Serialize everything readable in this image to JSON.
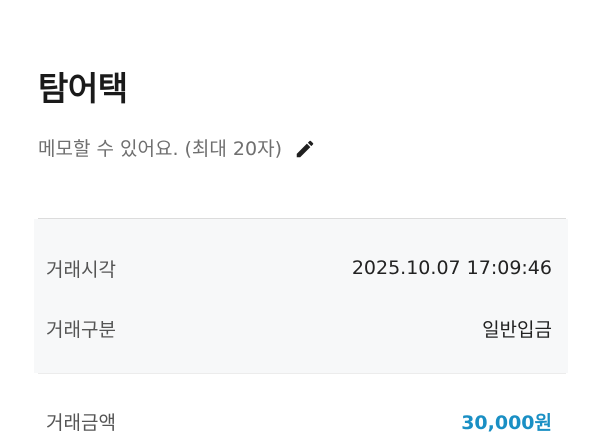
{
  "header": {
    "title": "탐어택"
  },
  "memo": {
    "placeholder": "메모할 수 있어요. (최대 20자)",
    "edit_icon": "pencil-icon"
  },
  "details": {
    "time_label": "거래시각",
    "time_value": "2025.10.07 17:09:46",
    "type_label": "거래구분",
    "type_value": "일반입금"
  },
  "amount": {
    "label": "거래금액",
    "value": "30,000원",
    "color": "#1a8fc4"
  }
}
